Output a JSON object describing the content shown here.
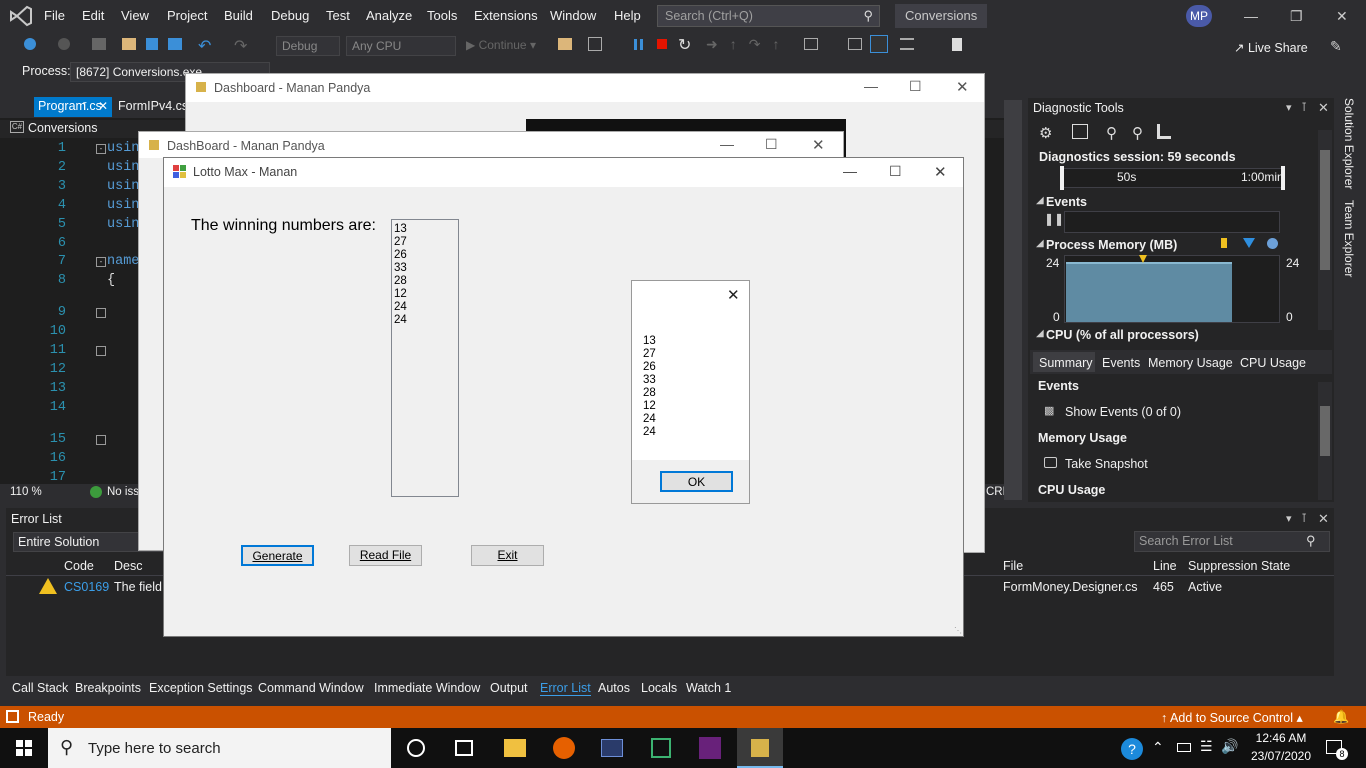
{
  "menubar": {
    "items": [
      "File",
      "Edit",
      "View",
      "Project",
      "Build",
      "Debug",
      "Test",
      "Analyze",
      "Tools",
      "Extensions",
      "Window",
      "Help"
    ],
    "search_placeholder": "Search (Ctrl+Q)",
    "solution": "Conversions",
    "avatar": "MP"
  },
  "toolbar": {
    "config": "Debug",
    "platform": "Any CPU",
    "continue": "Continue",
    "live_share": "Live Share",
    "process_label": "Process:",
    "process_value": "[8672] Conversions.exe"
  },
  "editor": {
    "tabs": [
      "Program.cs",
      "FormIPv4.cs"
    ],
    "class_dropdown": "Conversions",
    "line_numbers": [
      "1",
      "2",
      "3",
      "4",
      "5",
      "6",
      "7",
      "8",
      "9",
      "10",
      "11",
      "12",
      "13",
      "14",
      "15",
      "16",
      "17"
    ],
    "code_using": "usin",
    "code_name": "name",
    "zoom": "110 %",
    "issues": "No iss",
    "line_ending": "CRLF"
  },
  "diagnostics": {
    "title": "Diagnostic Tools",
    "session": "Diagnostics session: 59 seconds",
    "ruler_labels": [
      "50s",
      "1:00min"
    ],
    "events_label": "Events",
    "memory_label": "Process Memory (MB)",
    "memory_max": "24",
    "memory_min": "0",
    "cpu_label": "CPU (% of all processors)",
    "tabs": [
      "Summary",
      "Events",
      "Memory Usage",
      "CPU Usage"
    ],
    "sections": {
      "events": "Events",
      "show_events": "Show Events (0 of 0)",
      "memory_usage": "Memory Usage",
      "take_snapshot": "Take Snapshot",
      "cpu_usage": "CPU Usage"
    }
  },
  "side_tabs": [
    "Solution Explorer",
    "Team Explorer"
  ],
  "error_list": {
    "title": "Error List",
    "scope": "Entire Solution",
    "search_placeholder": "Search Error List",
    "columns": [
      "Code",
      "Desc",
      "File",
      "Line",
      "Suppression State"
    ],
    "rows": [
      {
        "code": "CS0169",
        "desc": "The field",
        "file": "FormMoney.Designer.cs",
        "line": "465",
        "state": "Active"
      }
    ]
  },
  "bottom_tabs": [
    "Call Stack",
    "Breakpoints",
    "Exception Settings",
    "Command Window",
    "Immediate Window",
    "Output",
    "Error List",
    "Autos",
    "Locals",
    "Watch 1"
  ],
  "statusbar": {
    "ready": "Ready",
    "source_control": "Add to Source Control"
  },
  "taskbar": {
    "search": "Type here to search",
    "time": "12:46 AM",
    "date": "23/07/2020",
    "notif_count": "8"
  },
  "dash1": {
    "title": "Dashboard - Manan Pandya"
  },
  "dash2": {
    "title": "DashBoard - Manan Pandya"
  },
  "lotto": {
    "title": "Lotto Max - Manan",
    "label": "The winning numbers are:",
    "numbers": [
      "13",
      "27",
      "26",
      "33",
      "28",
      "12",
      "24",
      "24"
    ],
    "buttons": {
      "generate": "Generate",
      "read_file": "Read File",
      "exit": "Exit"
    }
  },
  "msgbox": {
    "numbers": [
      "13",
      "27",
      "26",
      "33",
      "28",
      "12",
      "24",
      "24"
    ],
    "ok": "OK"
  },
  "colors": {
    "vs_bg": "#2d2d30",
    "editor_bg": "#1e1e1e",
    "accent": "#007acc",
    "status": "#ca5100",
    "memory_fill": "#5f8ba3"
  }
}
